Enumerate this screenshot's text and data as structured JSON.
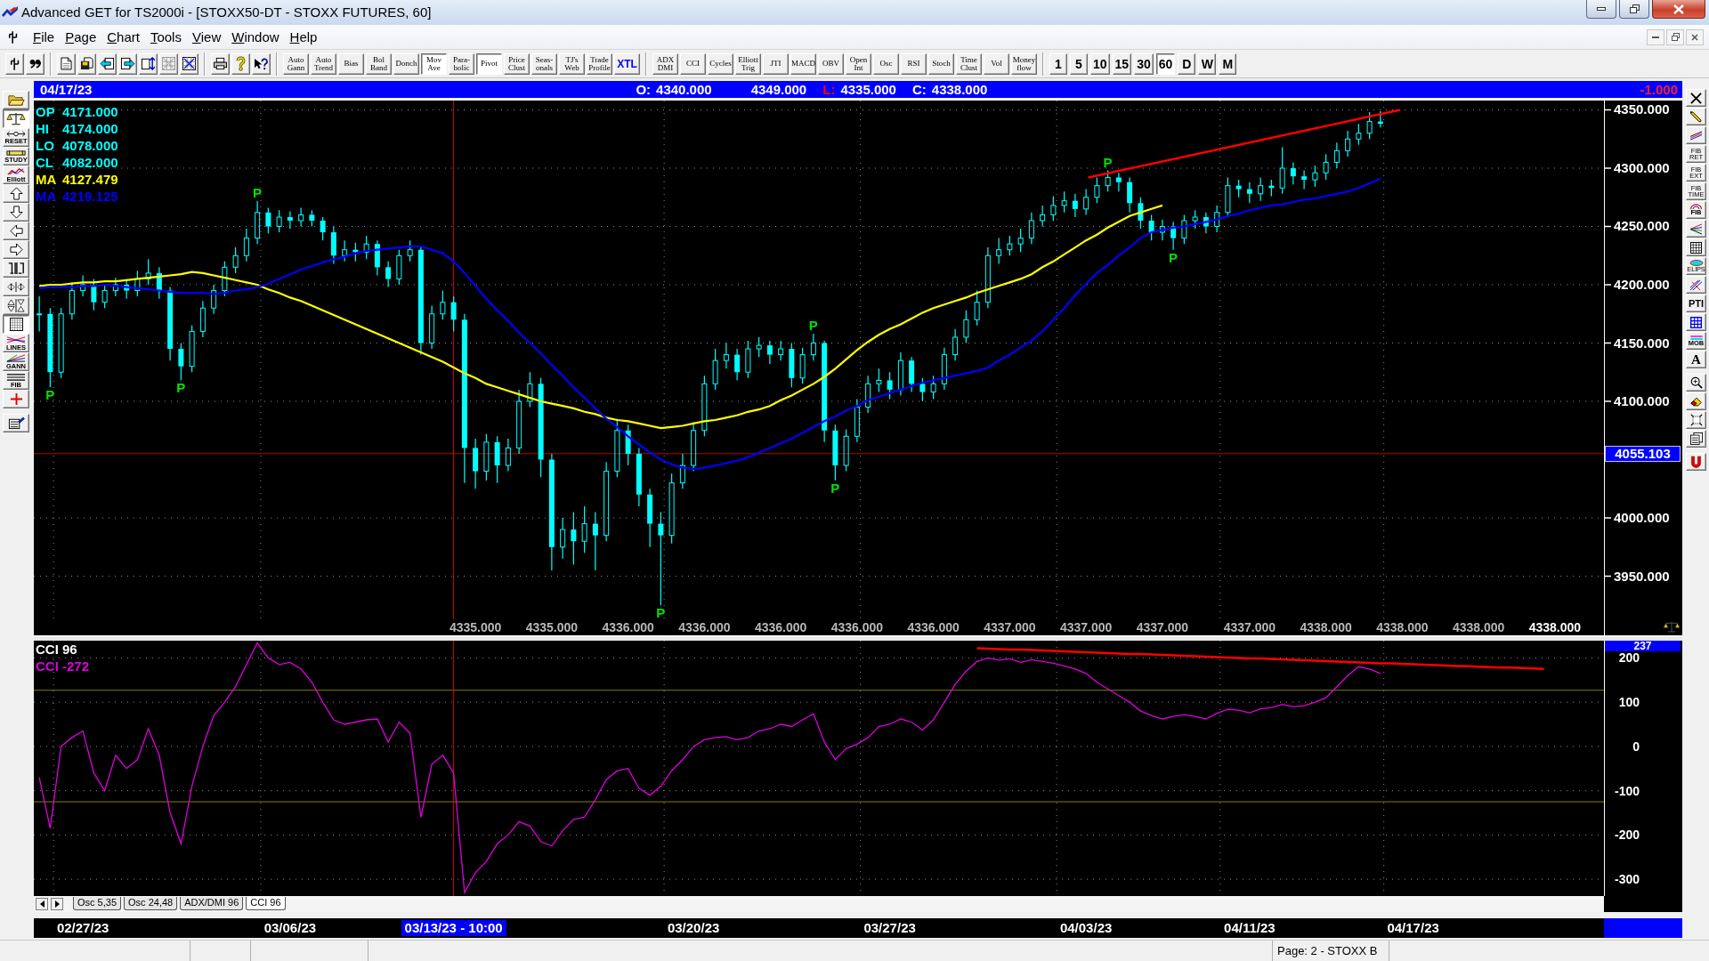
{
  "window": {
    "title": "Advanced GET for TS2000i - [STOXX50-DT - STOXX FUTURES, 60]"
  },
  "menu": [
    "File",
    "Page",
    "Chart",
    "Tools",
    "View",
    "Window",
    "Help"
  ],
  "toolbar": {
    "icon_groups": [
      {
        "buttons": [
          {
            "kind": "pin",
            "disabled": false
          },
          {
            "kind": "quote",
            "disabled": false
          }
        ]
      },
      {
        "buttons": [
          {
            "kind": "page",
            "disabled": false
          },
          {
            "kind": "save",
            "disabled": false
          },
          {
            "kind": "page-back",
            "disabled": false
          },
          {
            "kind": "page-forward",
            "disabled": false
          },
          {
            "kind": "page-swap",
            "disabled": false
          },
          {
            "kind": "delete",
            "disabled": true
          },
          {
            "kind": "grid-arrows",
            "disabled": false
          }
        ]
      },
      {
        "buttons": [
          {
            "kind": "print",
            "disabled": false
          },
          {
            "kind": "help",
            "disabled": false
          },
          {
            "kind": "context-help",
            "disabled": false
          }
        ]
      }
    ],
    "study_groups": [
      {
        "buttons": [
          {
            "label": "Auto Gann",
            "pressed": false
          },
          {
            "label": "Auto Trend",
            "pressed": false
          },
          {
            "label": "Bias",
            "pressed": false
          },
          {
            "label": "Bol Band",
            "pressed": false
          },
          {
            "label": "Donch",
            "pressed": false
          },
          {
            "label": "Mov Ave",
            "pressed": true
          },
          {
            "label": "Para-bolic",
            "pressed": false
          },
          {
            "label": "Pivot",
            "pressed": true
          },
          {
            "label": "Price Clust",
            "pressed": false
          },
          {
            "label": "Seas-onals",
            "pressed": false
          },
          {
            "label": "TJ's Web",
            "pressed": false
          },
          {
            "label": "Trade Profile",
            "pressed": false
          },
          {
            "label": "XTL",
            "pressed": false,
            "color": "#0000ff"
          }
        ]
      },
      {
        "buttons": [
          {
            "label": "ADX DMI",
            "pressed": false
          },
          {
            "label": "CCI",
            "pressed": false
          },
          {
            "label": "Cycles",
            "pressed": false
          },
          {
            "label": "Elliott Trig",
            "pressed": false
          },
          {
            "label": "JTI",
            "pressed": false
          },
          {
            "label": "MACD",
            "pressed": false
          },
          {
            "label": "OBV",
            "pressed": false
          },
          {
            "label": "Open Int",
            "pressed": false
          },
          {
            "label": "Osc",
            "pressed": false
          },
          {
            "label": "RSI",
            "pressed": false
          },
          {
            "label": "Stoch",
            "pressed": false
          },
          {
            "label": "Time Clust",
            "pressed": false
          },
          {
            "label": "Vol",
            "pressed": false
          },
          {
            "label": "Money flow",
            "pressed": false
          }
        ]
      }
    ],
    "intervals": [
      {
        "label": "1",
        "selected": false
      },
      {
        "label": "5",
        "selected": false
      },
      {
        "label": "10",
        "selected": false
      },
      {
        "label": "15",
        "selected": false
      },
      {
        "label": "30",
        "selected": false
      },
      {
        "label": "60",
        "selected": true
      },
      {
        "label": "D",
        "selected": false
      },
      {
        "label": "W",
        "selected": false
      },
      {
        "label": "M",
        "selected": false
      }
    ]
  },
  "left_toolbar": {
    "groups": [
      {
        "buttons": [
          {
            "kind": "folder",
            "pressed": false
          },
          {
            "kind": "scales",
            "pressed": true
          },
          {
            "kind": "reset",
            "label": "RESET",
            "pressed": false
          },
          {
            "kind": "study",
            "label": "STUDY",
            "pressed": false
          },
          {
            "kind": "elliott",
            "label": "Elliott",
            "pressed": false
          },
          {
            "kind": "arrow-up",
            "pressed": false
          },
          {
            "kind": "arrow-down",
            "pressed": false
          },
          {
            "kind": "arrow-left",
            "pressed": false
          },
          {
            "kind": "arrow-right",
            "pressed": false
          },
          {
            "kind": "squeeze",
            "pressed": false
          },
          {
            "kind": "h-zoom",
            "pressed": false
          },
          {
            "kind": "v-zoom",
            "pressed": false
          },
          {
            "kind": "dotted-grid",
            "pressed": true
          },
          {
            "kind": "lines",
            "label": "LINES",
            "pressed": false
          },
          {
            "kind": "gann",
            "label": "GANN",
            "pressed": false
          },
          {
            "kind": "fib",
            "label": "FIB",
            "pressed": false
          },
          {
            "kind": "crosshair",
            "pressed": false
          }
        ]
      },
      {
        "buttons": [
          {
            "kind": "report",
            "pressed": false
          }
        ]
      }
    ]
  },
  "header": {
    "date": "04/17/23",
    "values": [
      {
        "label": "O:",
        "value": "4340.000",
        "highlighted": false
      },
      {
        "value": "4349.000",
        "highlighted": false
      },
      {
        "label": "L:",
        "value": "4335.000",
        "highlighted": true
      },
      {
        "label": "C:",
        "value": "4338.000",
        "highlighted": false
      }
    ],
    "change": "-1.000"
  },
  "cursor": {
    "label": "03/13/23 - 10:00"
  },
  "price_panel": {
    "legend": [
      {
        "label": "OP",
        "value": "4171.000",
        "color": "#00ffff"
      },
      {
        "label": "HI",
        "value": "4174.000",
        "color": "#00ffff"
      },
      {
        "label": "LO",
        "value": "4078.000",
        "color": "#00ffff"
      },
      {
        "label": "CL",
        "value": "4082.000",
        "color": "#00ffff"
      },
      {
        "label": "MA",
        "value": "4127.479",
        "color": "#ffff00"
      },
      {
        "label": "MA",
        "value": "4219.125",
        "color": "#0000ff"
      }
    ],
    "last_label_highlighted": true,
    "chart_data": {
      "type": "candlestick",
      "grid": true,
      "categories": [
        null,
        null,
        null,
        null,
        null,
        null,
        null,
        null,
        null,
        null,
        null,
        null,
        null,
        null,
        null,
        null,
        null,
        null,
        null,
        null,
        null,
        null,
        null,
        null,
        null,
        null,
        null,
        null,
        null,
        null,
        null,
        null,
        null,
        null,
        null,
        null,
        null,
        null,
        null,
        null,
        "4335.000",
        null,
        null,
        null,
        null,
        null,
        null,
        "4335.000",
        null,
        null,
        null,
        null,
        null,
        null,
        "4336.000",
        null,
        null,
        null,
        null,
        null,
        null,
        "4336.000",
        null,
        null,
        null,
        null,
        null,
        null,
        "4336.000",
        null,
        null,
        null,
        null,
        null,
        null,
        "4336.000",
        null,
        null,
        null,
        null,
        null,
        null,
        "4336.000",
        null,
        null,
        null,
        null,
        null,
        null,
        "4337.000",
        null,
        null,
        null,
        null,
        null,
        null,
        "4337.000",
        null,
        null,
        null,
        null,
        null,
        null,
        "4337.000",
        null,
        null,
        null,
        null,
        null,
        null,
        null,
        "4337.000",
        null,
        null,
        null,
        null,
        null,
        null,
        "4338.000",
        null,
        null,
        null,
        null,
        null,
        null,
        "4338.000",
        null,
        null,
        null,
        null,
        null,
        null,
        "4338.000",
        null,
        null,
        null,
        null,
        null,
        null,
        "4338.000",
        null,
        null,
        null,
        null
      ],
      "ylim": [
        3913,
        4358
      ],
      "yticks": [
        {
          "value": 4350,
          "label": "4350.000"
        },
        {
          "value": 4300,
          "label": "4300.000"
        },
        {
          "value": 4250,
          "label": "4250.000"
        },
        {
          "value": 4200,
          "label": "4200.000"
        },
        {
          "value": 4150,
          "label": "4150.000"
        },
        {
          "value": 4100,
          "label": "4100.000"
        },
        {
          "value": 4000,
          "label": "4000.000"
        },
        {
          "value": 3950,
          "label": "3950.000"
        }
      ],
      "ohlc": [
        [
          4175,
          4190,
          4160,
          4175
        ],
        [
          4175,
          4180,
          4112,
          4125
        ],
        [
          4125,
          4180,
          4120,
          4175
        ],
        [
          4175,
          4202,
          4170,
          4195
        ],
        [
          4195,
          4208,
          4190,
          4200
        ],
        [
          4200,
          4205,
          4178,
          4185
        ],
        [
          4185,
          4200,
          4180,
          4195
        ],
        [
          4195,
          4206,
          4190,
          4200
        ],
        [
          4200,
          4205,
          4188,
          4195
        ],
        [
          4195,
          4212,
          4190,
          4205
        ],
        [
          4205,
          4222,
          4200,
          4210
        ],
        [
          4210,
          4215,
          4188,
          4195
        ],
        [
          4195,
          4198,
          4135,
          4145
        ],
        [
          4145,
          4150,
          4118,
          4130
        ],
        [
          4130,
          4165,
          4125,
          4160
        ],
        [
          4160,
          4186,
          4155,
          4180
        ],
        [
          4180,
          4200,
          4175,
          4195
        ],
        [
          4195,
          4220,
          4190,
          4215
        ],
        [
          4215,
          4232,
          4210,
          4225
        ],
        [
          4225,
          4248,
          4220,
          4240
        ],
        [
          4240,
          4272,
          4235,
          4262
        ],
        [
          4262,
          4266,
          4244,
          4250
        ],
        [
          4250,
          4264,
          4245,
          4258
        ],
        [
          4258,
          4263,
          4248,
          4255
        ],
        [
          4255,
          4266,
          4250,
          4260
        ],
        [
          4260,
          4264,
          4250,
          4255
        ],
        [
          4255,
          4258,
          4238,
          4245
        ],
        [
          4245,
          4250,
          4218,
          4225
        ],
        [
          4225,
          4238,
          4220,
          4230
        ],
        [
          4230,
          4236,
          4220,
          4228
        ],
        [
          4228,
          4242,
          4222,
          4235
        ],
        [
          4235,
          4238,
          4208,
          4215
        ],
        [
          4215,
          4220,
          4198,
          4205
        ],
        [
          4205,
          4230,
          4200,
          4225
        ],
        [
          4225,
          4238,
          4220,
          4230
        ],
        [
          4230,
          4232,
          4140,
          4150
        ],
        [
          4150,
          4182,
          4145,
          4175
        ],
        [
          4175,
          4195,
          4170,
          4185
        ],
        [
          4185,
          4190,
          4160,
          4170
        ],
        [
          4170,
          4175,
          4030,
          4060
        ],
        [
          4060,
          4068,
          4025,
          4040
        ],
        [
          4040,
          4072,
          4032,
          4065
        ],
        [
          4065,
          4070,
          4030,
          4045
        ],
        [
          4045,
          4068,
          4040,
          4060
        ],
        [
          4060,
          4110,
          4055,
          4100
        ],
        [
          4100,
          4125,
          4095,
          4115
        ],
        [
          4115,
          4120,
          4035,
          4050
        ],
        [
          4050,
          4055,
          3955,
          3975
        ],
        [
          3975,
          4000,
          3965,
          3990
        ],
        [
          3990,
          4005,
          3960,
          3980
        ],
        [
          3980,
          4010,
          3970,
          3995
        ],
        [
          3995,
          4005,
          3955,
          3985
        ],
        [
          3985,
          4048,
          3980,
          4040
        ],
        [
          4040,
          4085,
          4035,
          4075
        ],
        [
          4075,
          4080,
          4045,
          4055
        ],
        [
          4055,
          4060,
          4010,
          4020
        ],
        [
          4020,
          4025,
          3975,
          3995
        ],
        [
          3995,
          4005,
          3925,
          3985
        ],
        [
          3985,
          4038,
          3978,
          4030
        ],
        [
          4030,
          4055,
          4025,
          4045
        ],
        [
          4045,
          4082,
          4040,
          4075
        ],
        [
          4075,
          4122,
          4070,
          4115
        ],
        [
          4115,
          4145,
          4110,
          4135
        ],
        [
          4135,
          4150,
          4128,
          4140
        ],
        [
          4140,
          4145,
          4118,
          4125
        ],
        [
          4125,
          4152,
          4120,
          4145
        ],
        [
          4145,
          4155,
          4138,
          4148
        ],
        [
          4148,
          4152,
          4132,
          4140
        ],
        [
          4140,
          4152,
          4135,
          4145
        ],
        [
          4145,
          4150,
          4112,
          4120
        ],
        [
          4120,
          4146,
          4115,
          4140
        ],
        [
          4140,
          4158,
          4135,
          4150
        ],
        [
          4150,
          4152,
          4065,
          4075
        ],
        [
          4075,
          4080,
          4032,
          4045
        ],
        [
          4045,
          4076,
          4040,
          4070
        ],
        [
          4070,
          4102,
          4065,
          4095
        ],
        [
          4095,
          4122,
          4090,
          4115
        ],
        [
          4115,
          4128,
          4108,
          4118
        ],
        [
          4118,
          4125,
          4102,
          4110
        ],
        [
          4110,
          4142,
          4105,
          4135
        ],
        [
          4135,
          4138,
          4108,
          4115
        ],
        [
          4115,
          4120,
          4100,
          4108
        ],
        [
          4108,
          4122,
          4102,
          4115
        ],
        [
          4115,
          4146,
          4110,
          4140
        ],
        [
          4140,
          4162,
          4135,
          4155
        ],
        [
          4155,
          4178,
          4150,
          4170
        ],
        [
          4170,
          4195,
          4165,
          4185
        ],
        [
          4185,
          4232,
          4180,
          4225
        ],
        [
          4225,
          4240,
          4218,
          4230
        ],
        [
          4230,
          4242,
          4225,
          4235
        ],
        [
          4235,
          4248,
          4228,
          4240
        ],
        [
          4240,
          4262,
          4235,
          4255
        ],
        [
          4255,
          4268,
          4250,
          4260
        ],
        [
          4260,
          4276,
          4255,
          4268
        ],
        [
          4268,
          4280,
          4262,
          4272
        ],
        [
          4272,
          4278,
          4258,
          4265
        ],
        [
          4265,
          4282,
          4260,
          4275
        ],
        [
          4275,
          4292,
          4270,
          4285
        ],
        [
          4285,
          4298,
          4280,
          4292
        ],
        [
          4292,
          4296,
          4280,
          4288
        ],
        [
          4288,
          4292,
          4262,
          4270
        ],
        [
          4270,
          4275,
          4248,
          4255
        ],
        [
          4255,
          4260,
          4238,
          4245
        ],
        [
          4245,
          4256,
          4238,
          4250
        ],
        [
          4250,
          4254,
          4230,
          4240
        ],
        [
          4240,
          4260,
          4235,
          4255
        ],
        [
          4255,
          4264,
          4248,
          4258
        ],
        [
          4258,
          4262,
          4244,
          4250
        ],
        [
          4250,
          4268,
          4245,
          4262
        ],
        [
          4262,
          4292,
          4258,
          4285
        ],
        [
          4285,
          4290,
          4275,
          4282
        ],
        [
          4282,
          4288,
          4270,
          4278
        ],
        [
          4278,
          4292,
          4272,
          4285
        ],
        [
          4285,
          4290,
          4276,
          4283
        ],
        [
          4283,
          4318,
          4278,
          4300
        ],
        [
          4300,
          4305,
          4286,
          4293
        ],
        [
          4293,
          4298,
          4282,
          4290
        ],
        [
          4290,
          4302,
          4284,
          4296
        ],
        [
          4296,
          4312,
          4290,
          4305
        ],
        [
          4305,
          4322,
          4300,
          4315
        ],
        [
          4315,
          4332,
          4310,
          4325
        ],
        [
          4325,
          4338,
          4320,
          4330
        ],
        [
          4330,
          4348,
          4325,
          4340
        ],
        [
          4340,
          4349,
          4335,
          4338
        ],
        null,
        null,
        null,
        null,
        null,
        null,
        null,
        null,
        null,
        null,
        null,
        null,
        null,
        null,
        null,
        null,
        null,
        null,
        null,
        null
      ],
      "series": [
        {
          "type": "line",
          "color": "#ffff00",
          "values": [
            4199,
            4200,
            4200,
            4201,
            4202,
            4202,
            4203,
            4203,
            4204,
            4205,
            4206,
            4207,
            4208,
            4209,
            4211,
            4210,
            4208,
            4206,
            4204,
            4202,
            4200,
            4196,
            4193,
            4189,
            4186,
            4182,
            4178,
            4174,
            4170,
            4166,
            4162,
            4158,
            4154,
            4150,
            4146,
            4142,
            4138,
            4134,
            4129,
            4124,
            4120,
            4115,
            4112,
            4109,
            4106,
            4103,
            4100,
            4098,
            4096,
            4094,
            4091,
            4089,
            4086,
            4084,
            4083,
            4081,
            4079,
            4077,
            4078,
            4079,
            4081,
            4083,
            4084,
            4086,
            4088,
            4091,
            4093,
            4096,
            4101,
            4105,
            4110,
            4115,
            4121,
            4128,
            4136,
            4144,
            4151,
            4157,
            4162,
            4166,
            4171,
            4176,
            4180,
            4183,
            4186,
            4189,
            4193,
            4196,
            4199,
            4202,
            4205,
            4209,
            4215,
            4220,
            4226,
            4232,
            4238,
            4243,
            4249,
            4254,
            4259,
            4262,
            4265,
            4268,
            null,
            null,
            null,
            null,
            null,
            null,
            null,
            null,
            null,
            null,
            null,
            null,
            null,
            null,
            null,
            null,
            null,
            null,
            null,
            null,
            null,
            null,
            null,
            null,
            null,
            null,
            null,
            null,
            null,
            null,
            null,
            null,
            null,
            null,
            null,
            null,
            null,
            null,
            null,
            null
          ]
        },
        {
          "type": "line",
          "color": "#0000ff",
          "values": [
            4197,
            4198,
            4198,
            4198,
            4199,
            4199,
            4200,
            4199,
            4198,
            4197,
            4196,
            4195,
            4194,
            4193,
            4193,
            4193,
            4192,
            4193,
            4195,
            4196,
            4198,
            4201,
            4205,
            4209,
            4213,
            4216,
            4219,
            4222,
            4224,
            4227,
            4229,
            4230,
            4231,
            4232,
            4233,
            4233,
            4230,
            4227,
            4220,
            4210,
            4199,
            4188,
            4178,
            4169,
            4159,
            4150,
            4141,
            4131,
            4122,
            4112,
            4103,
            4094,
            4085,
            4078,
            4070,
            4063,
            4056,
            4050,
            4046,
            4043,
            4042,
            4043,
            4045,
            4047,
            4049,
            4052,
            4056,
            4060,
            4064,
            4068,
            4073,
            4078,
            4083,
            4087,
            4092,
            4096,
            4101,
            4104,
            4107,
            4110,
            4113,
            4116,
            4118,
            4120,
            4122,
            4124,
            4126,
            4129,
            4135,
            4140,
            4146,
            4152,
            4160,
            4170,
            4180,
            4191,
            4201,
            4210,
            4217,
            4225,
            4232,
            4240,
            4245,
            4247,
            4249,
            4250,
            4252,
            4254,
            4256,
            4259,
            4261,
            4264,
            4266,
            4268,
            4269,
            4271,
            4273,
            4274,
            4276,
            4278,
            4280,
            4283,
            4287,
            4291,
            null,
            null,
            null,
            null,
            null,
            null,
            null,
            null,
            null,
            null,
            null,
            null,
            null,
            null,
            null,
            null,
            null,
            null,
            null,
            null
          ]
        }
      ],
      "ref_lines": [
        {
          "axis": "y",
          "value": 4055.103,
          "label": "4055.103"
        }
      ],
      "annotations": [
        "P",
        "P",
        "P",
        "P",
        "P",
        "P",
        "P",
        "P"
      ]
    }
  },
  "cci_panel": {
    "title": "CCI 96",
    "reading": "CCI -272",
    "axis_marker": "237",
    "chart_data": {
      "type": "line",
      "grid": true,
      "categories": [
        null,
        null,
        null,
        null,
        "02/27/23",
        null,
        null,
        null,
        null,
        null,
        null,
        null,
        null,
        null,
        null,
        null,
        null,
        null,
        null,
        null,
        null,
        null,
        null,
        "03/06/23",
        null,
        null,
        null,
        null,
        null,
        null,
        null,
        null,
        null,
        null,
        null,
        null,
        null,
        null,
        null,
        null,
        null,
        null,
        null,
        null,
        null,
        null,
        null,
        null,
        null,
        null,
        null,
        null,
        null,
        null,
        null,
        null,
        null,
        null,
        null,
        null,
        "03/20/23",
        null,
        null,
        null,
        null,
        null,
        null,
        null,
        null,
        null,
        null,
        null,
        null,
        null,
        null,
        null,
        null,
        null,
        "03/27/23",
        null,
        null,
        null,
        null,
        null,
        null,
        null,
        null,
        null,
        null,
        null,
        null,
        null,
        null,
        null,
        null,
        null,
        "04/03/23",
        null,
        null,
        null,
        null,
        null,
        null,
        null,
        null,
        null,
        null,
        null,
        null,
        null,
        null,
        "04/11/23",
        null,
        null,
        null,
        null,
        null,
        null,
        null,
        null,
        null,
        null,
        null,
        null,
        null,
        null,
        "04/17/23",
        null,
        null,
        null,
        null,
        null,
        null,
        null,
        null,
        null,
        null,
        null,
        null,
        null,
        null,
        null,
        null,
        null
      ],
      "ylim": [
        -338,
        239
      ],
      "yticks": [
        200,
        100,
        0,
        -100,
        -200,
        -300
      ],
      "series": [
        {
          "color": "#dd00dd",
          "values": [
            -70,
            -185,
            0,
            20,
            35,
            -60,
            -100,
            -20,
            -50,
            -30,
            40,
            -20,
            -150,
            -220,
            -90,
            0,
            70,
            100,
            135,
            185,
            234,
            200,
            185,
            190,
            175,
            145,
            100,
            60,
            50,
            55,
            60,
            62,
            10,
            55,
            30,
            -160,
            -40,
            -20,
            -60,
            -330,
            -285,
            -260,
            -220,
            -200,
            -170,
            -180,
            -215,
            -225,
            -190,
            -165,
            -160,
            -120,
            -75,
            -55,
            -50,
            -95,
            -110,
            -90,
            -55,
            -30,
            0,
            15,
            20,
            22,
            15,
            20,
            35,
            40,
            50,
            45,
            60,
            74,
            10,
            -30,
            -5,
            5,
            20,
            45,
            50,
            62,
            55,
            37,
            60,
            100,
            140,
            170,
            192,
            200,
            195,
            198,
            190,
            196,
            192,
            188,
            182,
            175,
            165,
            145,
            130,
            115,
            100,
            80,
            70,
            62,
            68,
            72,
            68,
            62,
            75,
            84,
            82,
            76,
            85,
            88,
            95,
            90,
            92,
            100,
            110,
            135,
            160,
            180,
            175,
            165,
            null,
            null,
            null,
            null,
            null,
            null,
            null,
            null,
            null,
            null,
            null,
            null,
            null,
            null,
            null,
            null,
            null,
            null,
            null,
            null
          ]
        },
        {
          "color": "#ff0000",
          "values": [
            null,
            null,
            null,
            null,
            null,
            null,
            null,
            null,
            null,
            null,
            null,
            null,
            null,
            null,
            null,
            null,
            null,
            null,
            null,
            null,
            null,
            null,
            null,
            null,
            null,
            null,
            null,
            null,
            null,
            null,
            null,
            null,
            null,
            null,
            null,
            null,
            null,
            null,
            null,
            null,
            null,
            null,
            null,
            null,
            null,
            null,
            null,
            null,
            null,
            null,
            null,
            null,
            null,
            null,
            null,
            null,
            null,
            null,
            null,
            null,
            null,
            null,
            null,
            null,
            null,
            null,
            null,
            null,
            null,
            null,
            null,
            null,
            null,
            null,
            null,
            null,
            null,
            null,
            null,
            null,
            null,
            null,
            null,
            null,
            null,
            null,
            222,
            221,
            220,
            219,
            219,
            218,
            217,
            216,
            215,
            214,
            213,
            212,
            211,
            210,
            209,
            209,
            208,
            207,
            206,
            205,
            204,
            203,
            202,
            201,
            200,
            199,
            199,
            198,
            197,
            196,
            195,
            194,
            193,
            192,
            191,
            190,
            189,
            188,
            188,
            187,
            186,
            185,
            184,
            183,
            182,
            181,
            180,
            179,
            178,
            178,
            177,
            176,
            175,
            null,
            null,
            null,
            null,
            null
          ]
        }
      ],
      "ref_lines": [
        {
          "axis": "y",
          "value": 127
        },
        {
          "axis": "y",
          "value": -125
        }
      ]
    }
  },
  "tabs": [
    {
      "label": "Osc 5,35",
      "selected": false
    },
    {
      "label": "Osc 24,48",
      "selected": false
    },
    {
      "label": "ADX/DMI 96",
      "selected": false
    },
    {
      "label": "CCI 96",
      "selected": true
    }
  ],
  "right_toolbar": {
    "groups": [
      {
        "buttons": [
          {
            "kind": "x"
          },
          {
            "kind": "pencil"
          },
          {
            "kind": "channel"
          },
          {
            "kind": "small-label",
            "label": "FIB RET"
          },
          {
            "kind": "small-label",
            "label": "FIB EXT"
          },
          {
            "kind": "small-label",
            "label": "FIB TIME"
          },
          {
            "kind": "fib-arc",
            "label": "FIB"
          },
          {
            "kind": "fan"
          },
          {
            "kind": "grid"
          },
          {
            "kind": "ellipse",
            "label": "ELIPS"
          },
          {
            "kind": "crossed-lines"
          },
          {
            "kind": "bold-label",
            "label": "PTI"
          },
          {
            "kind": "blue-grid"
          },
          {
            "kind": "mob",
            "label": "MOB"
          },
          {
            "kind": "serif-label",
            "label": "A"
          }
        ]
      },
      {
        "buttons": [
          {
            "kind": "zoom"
          },
          {
            "kind": "eraser"
          },
          {
            "kind": "fit"
          },
          {
            "kind": "pages"
          }
        ]
      },
      {
        "buttons": [
          {
            "kind": "magnet"
          }
        ]
      }
    ]
  },
  "status_bar": {
    "text": "Page: 2 - STOXX B"
  }
}
